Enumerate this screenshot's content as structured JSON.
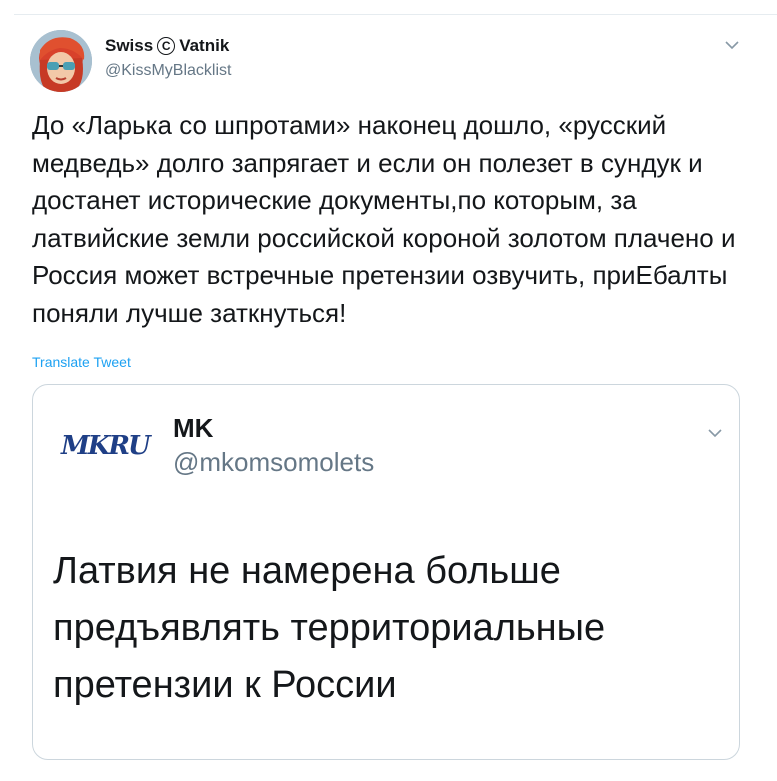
{
  "tweet": {
    "display_name_left": "Swiss",
    "copyright_symbol": "C",
    "display_name_right": "Vatnik",
    "handle": "@KissMyBlacklist",
    "text": "До «Ларька со шпротами» наконец дошло, «русский медведь» долго запрягает и если он полезет в сундук и достанет исторические документы,по которым, за латвийские земли российской короной золотом плачено и Россия может встречные претензии озвучить, приЕбалты поняли лучше заткнуться!",
    "translate_label": "Translate Tweet",
    "menu_icon": "chevron-down-icon"
  },
  "quoted": {
    "logo_text": "MKRU",
    "name": "MK",
    "handle": "@mkomsomolets",
    "text": "Латвия не намерена больше предъявлять территориальные претензии к России",
    "menu_icon": "chevron-down-icon"
  },
  "colors": {
    "link": "#1da1f2",
    "secondary": "#657786",
    "border": "#ccd6dd",
    "logo": "#1f3f86"
  }
}
